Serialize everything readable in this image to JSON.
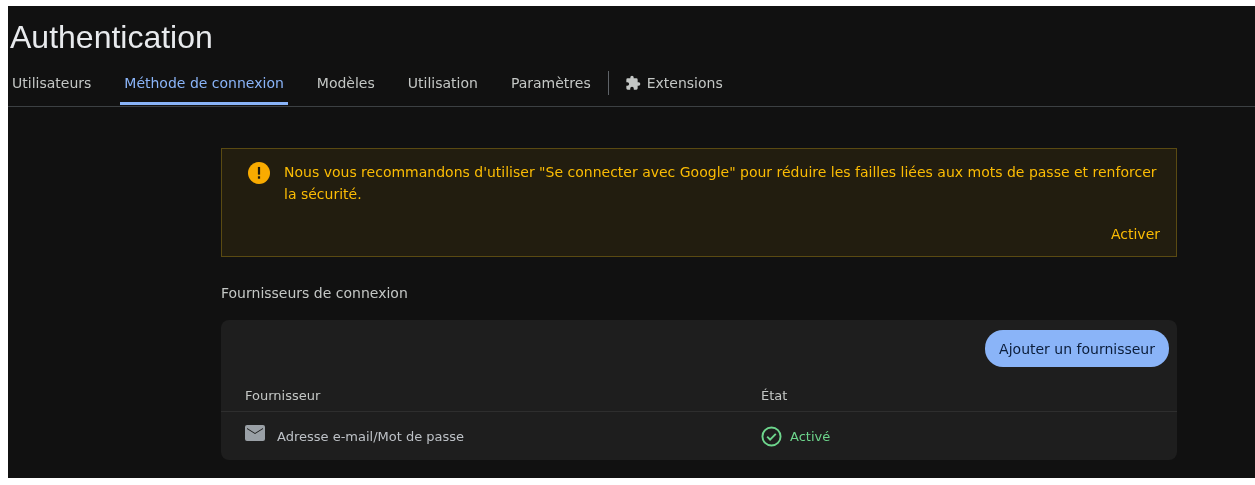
{
  "page": {
    "title": "Authentication"
  },
  "tabs": [
    {
      "label": "Utilisateurs",
      "selected": false,
      "kind": "plain"
    },
    {
      "label": "Méthode de connexion",
      "selected": true,
      "kind": "plain"
    },
    {
      "label": "Modèles",
      "selected": false,
      "kind": "plain"
    },
    {
      "label": "Utilisation",
      "selected": false,
      "kind": "plain"
    },
    {
      "label": "Paramètres",
      "selected": false,
      "kind": "plain"
    },
    {
      "label": "Extensions",
      "selected": false,
      "kind": "extension"
    }
  ],
  "banner": {
    "message": "Nous vous recommandons d'utiliser \"Se connecter avec Google\" pour réduire les failles liées aux mots de passe et renforcer la sécurité.",
    "action": "Activer"
  },
  "providers": {
    "heading": "Fournisseurs de connexion",
    "add_button": "Ajouter un fournisseur",
    "columns": [
      "Fournisseur",
      "État"
    ],
    "rows": [
      {
        "name": "Adresse e-mail/Mot de passe",
        "status": "Activé",
        "enabled": true
      }
    ]
  }
}
